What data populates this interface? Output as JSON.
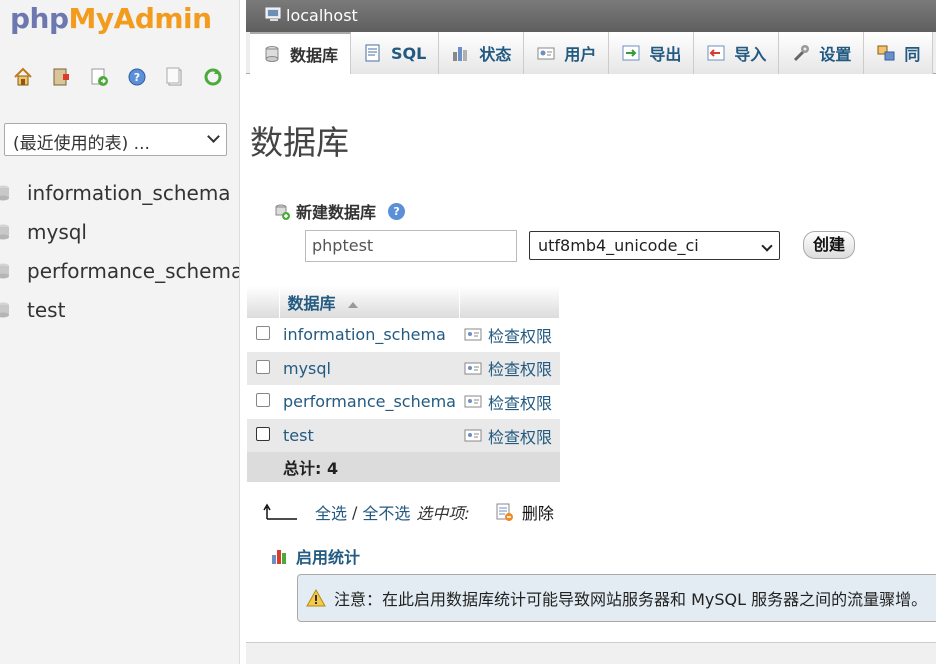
{
  "nav": {
    "logo": {
      "php": "php",
      "my": "My",
      "admin": "Admin"
    },
    "icons": [
      "home-icon",
      "exit-icon",
      "sql-query-icon",
      "docs-help-icon",
      "docs-icon",
      "reload-icon"
    ],
    "recent_select": "(最近使用的表) ...",
    "databases": [
      "information_schema",
      "mysql",
      "performance_schema",
      "test"
    ]
  },
  "main": {
    "server_title": "localhost",
    "tabs": [
      {
        "label": "数据库",
        "icon": "database-icon",
        "active": true
      },
      {
        "label": "SQL",
        "icon": "sql-icon",
        "active": false
      },
      {
        "label": "状态",
        "icon": "status-icon",
        "active": false
      },
      {
        "label": "用户",
        "icon": "users-icon",
        "active": false
      },
      {
        "label": "导出",
        "icon": "export-icon",
        "active": false
      },
      {
        "label": "导入",
        "icon": "import-icon",
        "active": false
      },
      {
        "label": "设置",
        "icon": "settings-icon",
        "active": false
      },
      {
        "label": "同",
        "icon": "replication-icon",
        "active": false
      }
    ],
    "page_title": "数据库",
    "new_db": {
      "heading": "新建数据库",
      "name_value": "phptest",
      "collation": "utf8mb4_unicode_ci",
      "create_label": "创建"
    },
    "table": {
      "header_db": "数据库",
      "rows": [
        {
          "name": "information_schema",
          "action": "检查权限"
        },
        {
          "name": "mysql",
          "action": "检查权限"
        },
        {
          "name": "performance_schema",
          "action": "检查权限"
        },
        {
          "name": "test",
          "action": "检查权限"
        }
      ],
      "total_label": "总计: 4"
    },
    "with_selected": {
      "check_all": "全选",
      "separator": "/",
      "uncheck_all": "全不选",
      "label": "选中项:",
      "delete_label": "删除"
    },
    "enable_stats": "启用统计",
    "notice": "注意：在此启用数据库统计可能导致网站服务器和 MySQL 服务器之间的流量骤增。"
  }
}
